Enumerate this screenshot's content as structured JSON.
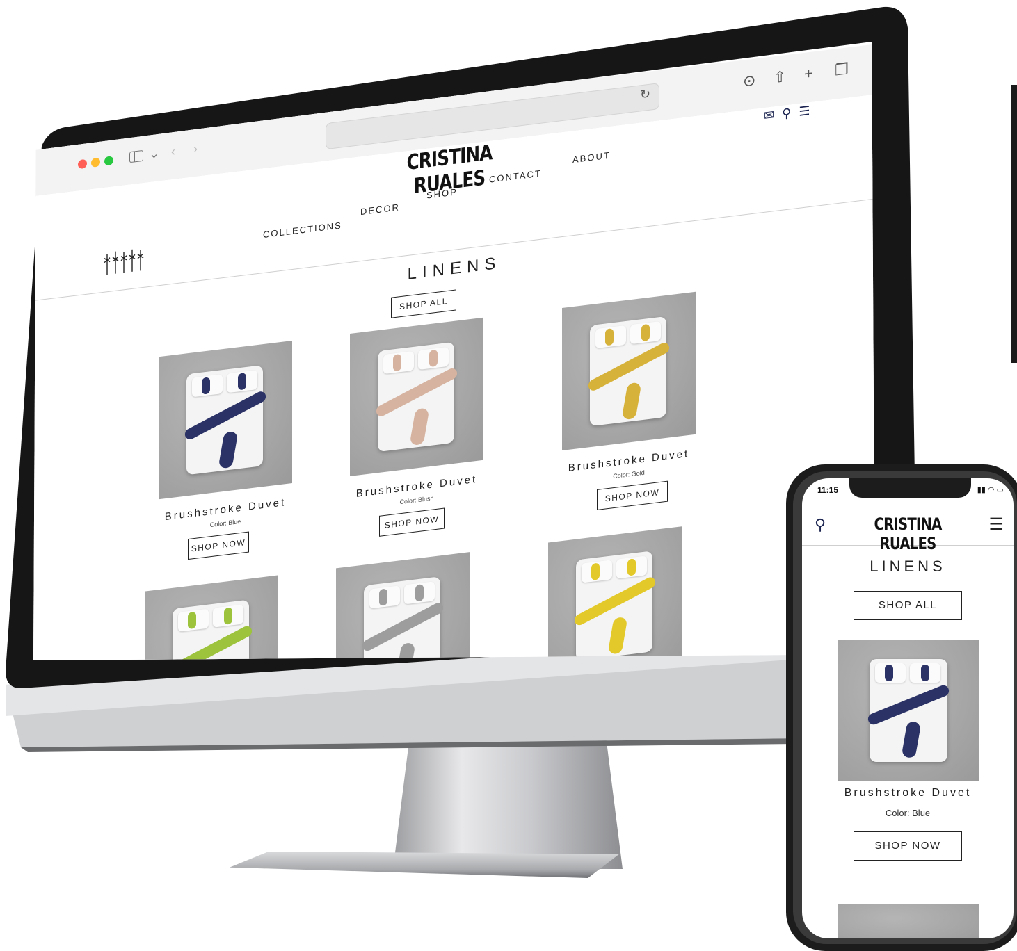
{
  "desktop": {
    "brand": "CRISTINA RUALES",
    "nav": [
      "COLLECTIONS",
      "DECOR",
      "SHOP",
      "CONTACT",
      "ABOUT"
    ],
    "page_title": "LINENS",
    "shop_all_label": "SHOP ALL",
    "products": [
      {
        "name": "Brushstroke Duvet",
        "color_label": "Color: Blue",
        "button": "SHOP NOW",
        "accent": "#2b3266"
      },
      {
        "name": "Brushstroke Duvet",
        "color_label": "Color: Blush",
        "button": "SHOP NOW",
        "accent": "#d6b3a0"
      },
      {
        "name": "Brushstroke Duvet",
        "color_label": "Color: Gold",
        "button": "SHOP NOW",
        "accent": "#d7b23a"
      },
      {
        "accent": "#9cc33b"
      },
      {
        "accent": "#9d9d9d"
      },
      {
        "accent": "#e3c92a"
      }
    ],
    "icons": {
      "mail": "mail-icon",
      "search": "search-icon",
      "menu": "menu-icon",
      "download": "download-icon",
      "share": "share-icon",
      "new_tab": "plus-icon",
      "tabs": "tabs-icon",
      "reload": "reload-icon"
    }
  },
  "mobile": {
    "time": "11:15",
    "brand": "CRISTINA RUALES",
    "page_title": "LINENS",
    "shop_all_label": "SHOP ALL",
    "product": {
      "name": "Brushstroke Duvet",
      "color_label": "Color: Blue",
      "button": "SHOP NOW",
      "accent": "#2b3266"
    }
  }
}
